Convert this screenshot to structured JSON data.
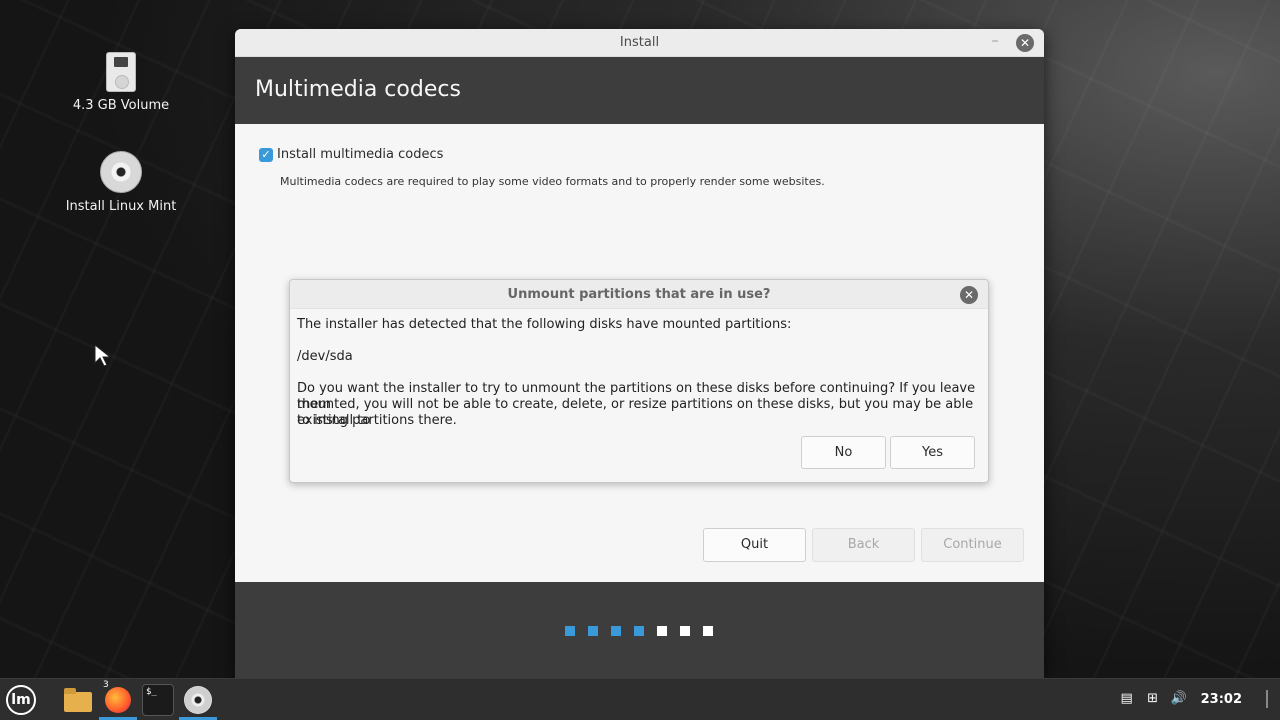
{
  "desktop": {
    "icons": [
      {
        "label": "4.3 GB Volume",
        "icon": "usb-drive-icon"
      },
      {
        "label": "Install Linux Mint",
        "icon": "cd-disc-icon"
      }
    ]
  },
  "installer": {
    "window_title": "Install",
    "header": "Multimedia codecs",
    "checkbox_label": "Install multimedia codecs",
    "checkbox_checked": true,
    "description": "Multimedia codecs are required to play some video formats and to properly render some websites.",
    "buttons": {
      "quit": "Quit",
      "back": "Back",
      "continue": "Continue"
    },
    "progress": {
      "done": 4,
      "total": 7
    },
    "accent": "#3a99d8"
  },
  "dialog": {
    "title": "Unmount partitions that are in use?",
    "line1": "The installer has detected that the following disks have mounted partitions:",
    "disk": "/dev/sda",
    "line2a": "Do you want the installer to try to unmount the partitions on these disks before continuing?  If you leave them",
    "line2b": "mounted, you will not be able to create, delete, or resize partitions on these disks, but you may be able to install to",
    "line2c": "existing partitions there.",
    "no": "No",
    "yes": "Yes"
  },
  "taskbar": {
    "firefox_badge": "3",
    "terminal_text": "$_",
    "clock": "23:02",
    "tray_icons": [
      "notes-icon",
      "network-icon",
      "volume-icon"
    ]
  }
}
